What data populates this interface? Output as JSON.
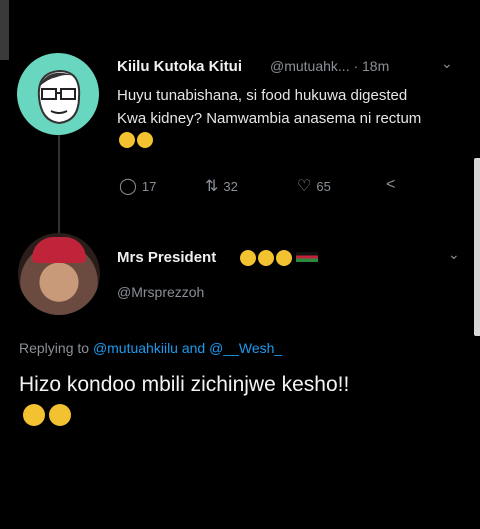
{
  "tweet1": {
    "name": "Kiilu Kutoka Kitui",
    "handle": "@mutuahk...",
    "time": "· 18m",
    "text": "Huyu tunabishana, si food hukuwa digested Kwa kidney? Namwambia anasema ni rectum",
    "replies": "17",
    "retweets": "32",
    "likes": "65"
  },
  "tweet2": {
    "name": "Mrs President",
    "handle": "@Mrsprezzoh",
    "replying_prefix": "Replying to",
    "replying_user1": "@mutuahkiilu",
    "replying_and": "and",
    "replying_user2": "@__Wesh_",
    "text": "Hizo kondoo mbili zichinjwe kesho!!"
  },
  "icons": {
    "reply": "reply-icon",
    "retweet": "retweet-icon",
    "like": "heart-icon",
    "share": "share-icon",
    "more": "chevron-down-icon"
  },
  "colors": {
    "link": "#1d9bf0",
    "avatar1_bg": "#69d6c0"
  }
}
